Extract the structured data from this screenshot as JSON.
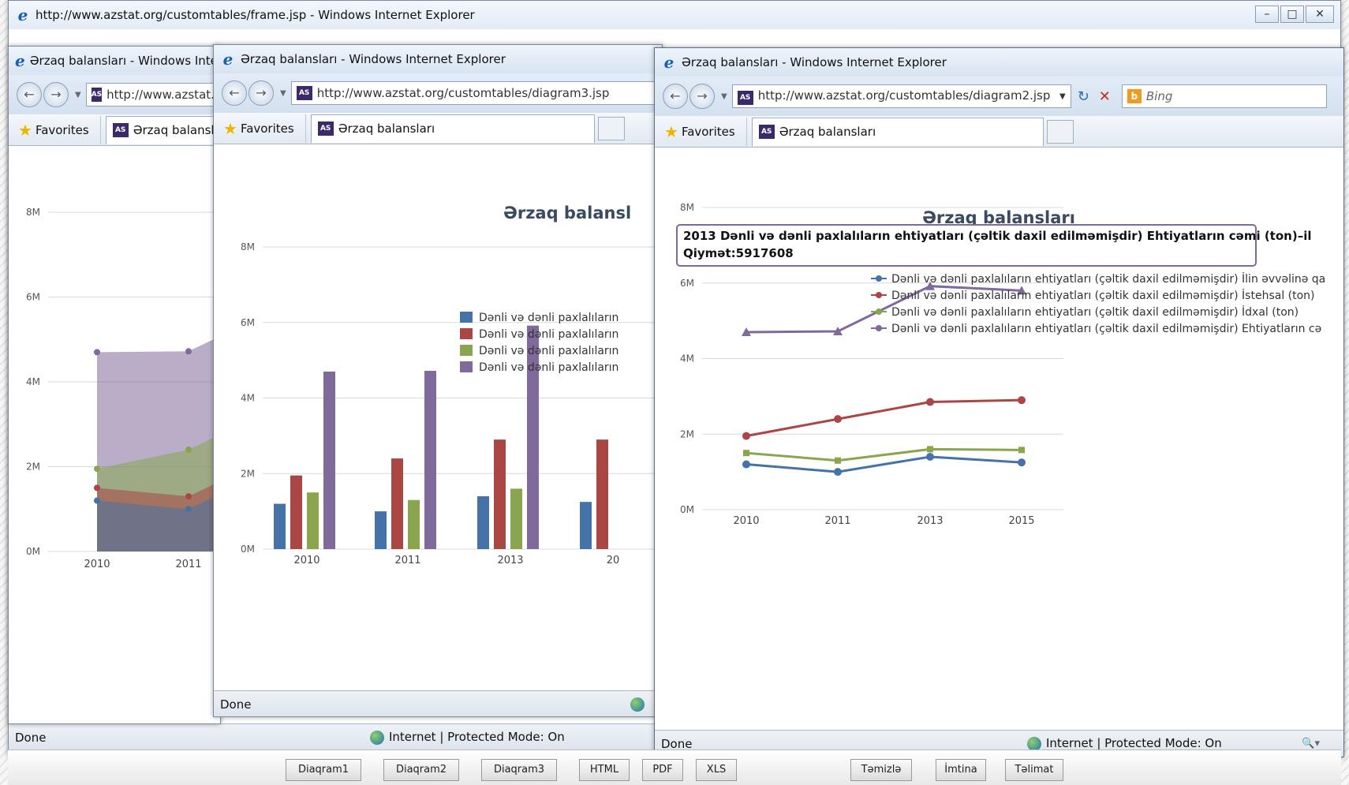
{
  "back_window": {
    "title": "http://www.azstat.org/customtables/frame.jsp - Windows Internet Explorer",
    "status": "Done",
    "zone": "Internet | Protected Mode: On"
  },
  "win1": {
    "title": "Ərzaq balansları - Windows Internet Explorer",
    "address": "http://www.azstat.or",
    "favorites": "Favorites",
    "tab": "Ərzaq balansları"
  },
  "win2": {
    "title": "Ərzaq balansları - Windows Internet Explorer",
    "address": "http://www.azstat.org/customtables/diagram3.jsp",
    "favorites": "Favorites",
    "tab": "Ərzaq balansları",
    "status": "Done"
  },
  "win3": {
    "title": "Ərzaq balansları - Windows Internet Explorer",
    "address": "http://www.azstat.org/customtables/diagram2.jsp",
    "search": "Bing",
    "favorites": "Favorites",
    "tab": "Ərzaq balansları",
    "status": "Done",
    "zone": "Internet | Protected Mode: On",
    "tooltip_line1": "2013 Dənli və dənli paxlalıların ehtiyatları (çəltik daxil edilməmişdir) Ehtiyatların cəmi (ton)–il",
    "tooltip_line2": "Qiymət:5917608"
  },
  "buttons": {
    "diaqram1": "Diaqram1",
    "diaqram2": "Diaqram2",
    "diaqram3": "Diaqram3",
    "html": "HTML",
    "pdf": "PDF",
    "xls": "XLS",
    "temizle": "Təmizlə",
    "imtina": "İmtina",
    "telimat": "Təlimat"
  },
  "colors": {
    "blue": "#4572a7",
    "red": "#aa4643",
    "green": "#89a54e",
    "purple": "#80699b"
  },
  "chart_data": [
    {
      "type": "area",
      "title": "",
      "categories": [
        "2010",
        "2011"
      ],
      "y_ticks": [
        "0M",
        "2M",
        "4M",
        "6M",
        "8M"
      ],
      "ylim": [
        0,
        8000000
      ],
      "series": [
        {
          "values": [
            1200000,
            1000000
          ]
        },
        {
          "values": [
            1500000,
            1300000
          ]
        },
        {
          "values": [
            1950000,
            2400000
          ]
        },
        {
          "values": [
            4700000,
            4720000
          ]
        }
      ]
    },
    {
      "type": "bar",
      "title": "Ərzaq balansl",
      "categories": [
        "2010",
        "2011",
        "2013",
        "20"
      ],
      "y_ticks": [
        "0M",
        "2M",
        "4M",
        "6M",
        "8M"
      ],
      "ylim": [
        0,
        8000000
      ],
      "legend": [
        "Dənli və dənli paxlalıların",
        "Dənli və dənli paxlalıların",
        "Dənli və dənli paxlalıların",
        "Dənli və dənli paxlalıların"
      ],
      "series": [
        {
          "values": [
            1200000,
            1000000,
            1400000,
            1250000
          ]
        },
        {
          "values": [
            1950000,
            2400000,
            2900000,
            2900000
          ]
        },
        {
          "values": [
            1500000,
            1300000,
            1600000,
            0
          ]
        },
        {
          "values": [
            4700000,
            4720000,
            5917608,
            0
          ]
        }
      ]
    },
    {
      "type": "line",
      "title": "Ərzaq balansları",
      "categories": [
        "2010",
        "2011",
        "2013",
        "2015"
      ],
      "y_ticks": [
        "0M",
        "2M",
        "4M",
        "6M",
        "8M"
      ],
      "ylim": [
        0,
        8000000
      ],
      "legend_placement": "top-right",
      "series": [
        {
          "name": "Dənli və dənli paxlalıların ehtiyatları (çəltik daxil edilməmişdir) İlin əvvəlinə qa",
          "values": [
            1200000,
            1000000,
            1400000,
            1250000
          ]
        },
        {
          "name": "Dənli və dənli paxlalıların ehtiyatları (çəltik daxil edilməmişdir) İstehsal (ton)",
          "values": [
            1950000,
            2400000,
            2850000,
            2900000
          ]
        },
        {
          "name": "Dənli və dənli paxlalıların ehtiyatları (çəltik daxil edilməmişdir) İdxal (ton)",
          "values": [
            1500000,
            1300000,
            1600000,
            1580000
          ]
        },
        {
          "name": "Dənli və dənli paxlalıların ehtiyatları (çəltik daxil edilməmişdir) Ehtiyatların cə",
          "values": [
            4700000,
            4720000,
            5917608,
            5800000
          ]
        }
      ]
    }
  ]
}
